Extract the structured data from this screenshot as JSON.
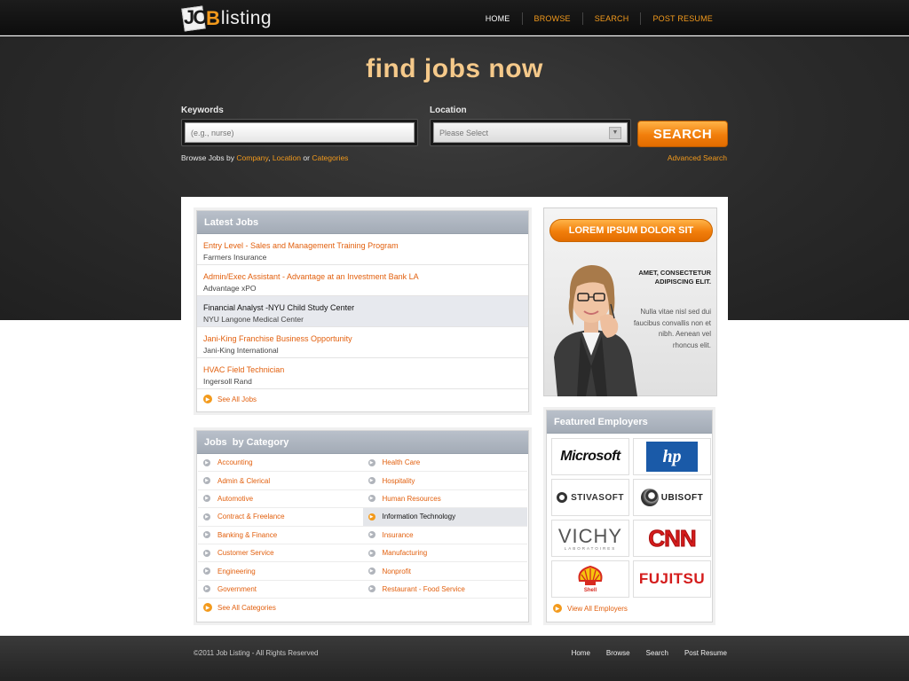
{
  "brand": {
    "logo_jo": "JO",
    "logo_b": "B",
    "logo_rest": "listing"
  },
  "nav": {
    "items": [
      "HOME",
      "BROWSE",
      "SEARCH",
      "POST RESUME"
    ]
  },
  "hero": {
    "title": "find jobs now",
    "keywords_label": "Keywords",
    "keywords_placeholder": "(e.g., nurse)",
    "location_label": "Location",
    "location_selected": "Please Select",
    "search_button": "SEARCH",
    "browse_prefix": "Browse Jobs by",
    "browse_company": "Company",
    "browse_sep": ",",
    "browse_location": "Location",
    "browse_or": "or",
    "browse_categories": "Categories",
    "advanced_search": "Advanced Search"
  },
  "latest_jobs": {
    "heading": "Latest Jobs",
    "items": [
      {
        "title": "Entry Level - Sales and Management Training Program",
        "company": "Farmers Insurance"
      },
      {
        "title": "Admin/Exec Assistant - Advantage at an Investment Bank LA",
        "company": "Advantage xPO"
      },
      {
        "title": "Financial Analyst -NYU Child Study Center",
        "company": "NYU Langone Medical Center"
      },
      {
        "title": "Jani-King Franchise Business Opportunity",
        "company": "Jani-King International"
      },
      {
        "title": "HVAC Field Technician",
        "company": "Ingersoll Rand"
      }
    ],
    "see_all": "See All Jobs"
  },
  "categories": {
    "heading": "Jobs  by Category",
    "left": [
      "Accounting",
      "Admin & Clerical",
      "Automotive",
      "Contract & Freelance",
      "Banking & Finance",
      "Customer Service",
      "Engineering",
      "Government"
    ],
    "right": [
      "Health Care",
      "Hospitality",
      "Human Resources",
      "Information Technology",
      "Insurance",
      "Manufacturing",
      "Nonprofit",
      "Restaurant - Food Service"
    ],
    "see_all": "See All Categories"
  },
  "promo": {
    "button": "LOREM IPSUM DOLOR SIT",
    "heading_line1": "AMET, CONSECTETUR",
    "heading_line2": "ADIPISCING ELIT.",
    "body": "Nulla vitae nisl sed dui faucibus convallis non et nibh. Aenean vel rhoncus elit."
  },
  "employers": {
    "heading": "Featured Employers",
    "logos": [
      "Microsoft",
      "hp",
      "STIVASOFT",
      "UBISOFT",
      "VICHY",
      "LABORATOIRES",
      "CNN",
      "Shell",
      "FUJITSU"
    ],
    "see_all": "View All Employers"
  },
  "footer": {
    "copyright": "©2011 Job Listing - All Rights Reserved",
    "links": [
      "Home",
      "Browse",
      "Search",
      "Post Resume"
    ]
  },
  "colors": {
    "accent": "#f39a1c",
    "link": "#e25f0d",
    "header_bar": "#a8b0bb",
    "dark_bg": "#2a2a2a"
  }
}
